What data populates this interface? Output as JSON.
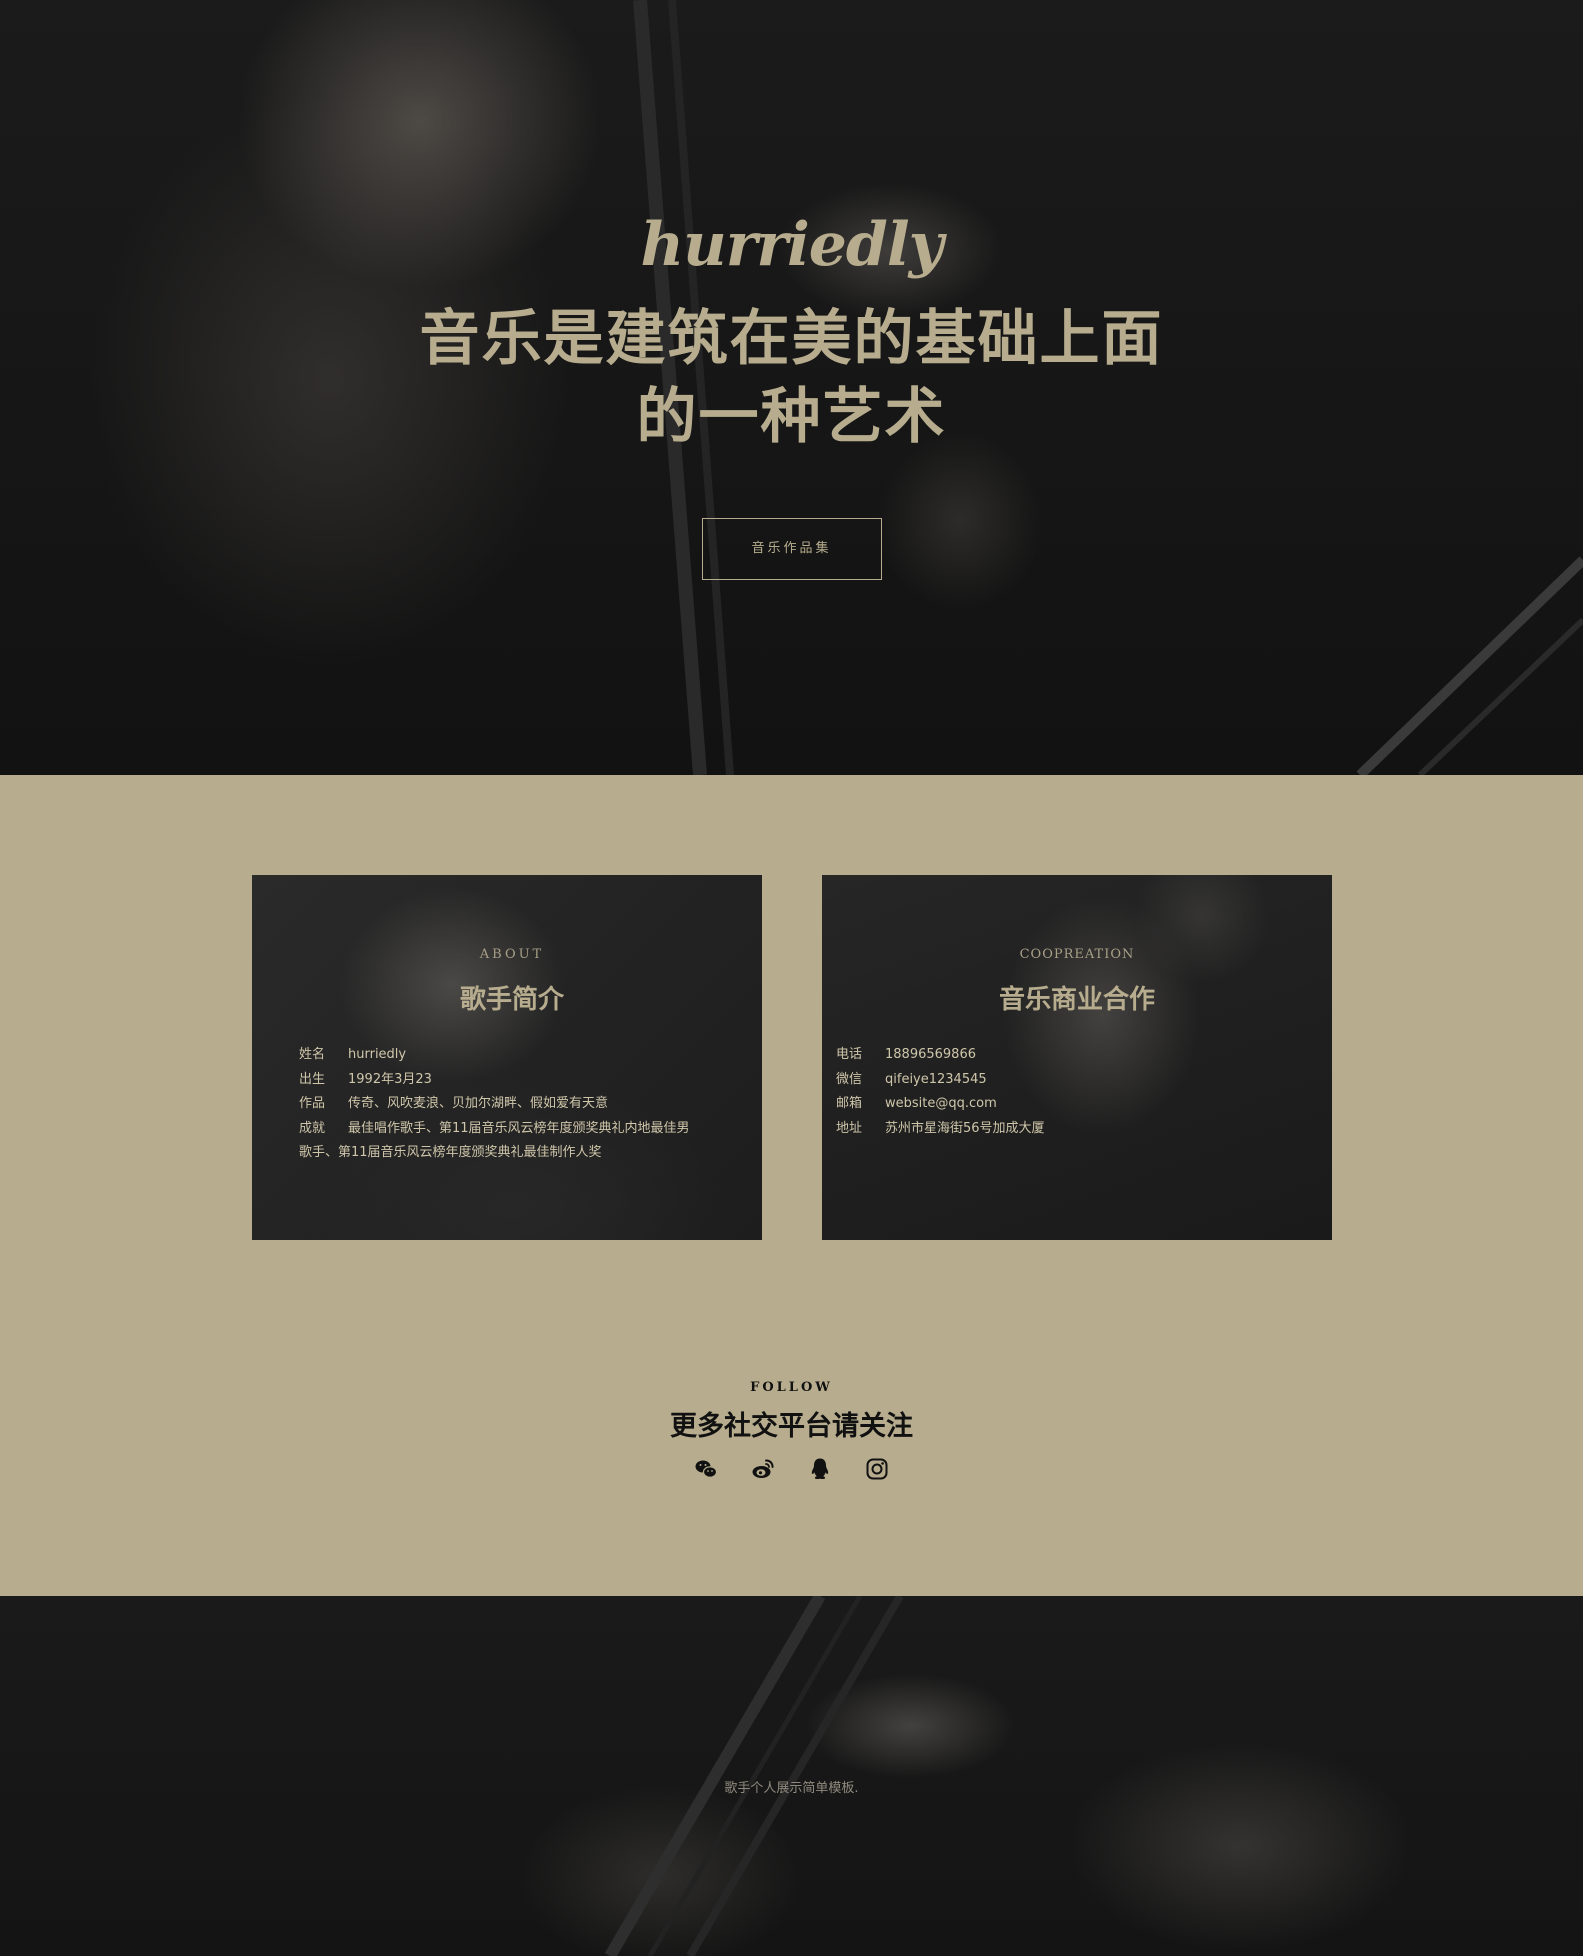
{
  "hero": {
    "logo": "hurriedly",
    "headline": "音乐是建筑在美的基础上面的一种艺术",
    "button_label": "音乐作品集"
  },
  "about": {
    "eyebrow": "ABOUT",
    "title": "歌手简介",
    "rows": [
      {
        "key": "姓名",
        "value": "hurriedly"
      },
      {
        "key": "出生",
        "value": "1992年3月23"
      },
      {
        "key": "作品",
        "value": "传奇、风吹麦浪、贝加尔湖畔、假如爱有天意"
      },
      {
        "key": "成就",
        "value": "最佳唱作歌手、第11届音乐风云榜年度颁奖典礼内地最佳男"
      }
    ],
    "overflow": "歌手、第11届音乐风云榜年度颁奖典礼最佳制作人奖"
  },
  "cooperation": {
    "eyebrow": "COOPREATION",
    "title": "音乐商业合作",
    "rows": [
      {
        "key": "电话",
        "value": "18896569866"
      },
      {
        "key": "微信",
        "value": "qifeiye1234545"
      },
      {
        "key": "邮箱",
        "value": "website@qq.com"
      },
      {
        "key": "地址",
        "value": "苏州市星海街56号加成大厦"
      }
    ]
  },
  "follow": {
    "eyebrow": "FOLLOW",
    "title": "更多社交平台请关注",
    "icons": [
      "wechat-icon",
      "weibo-icon",
      "qq-icon",
      "instagram-icon"
    ]
  },
  "footer": {
    "text": "歌手个人展示简单模板."
  },
  "colors": {
    "accent": "#b7ad8e",
    "dark": "#121212",
    "text_dark": "#111111"
  }
}
